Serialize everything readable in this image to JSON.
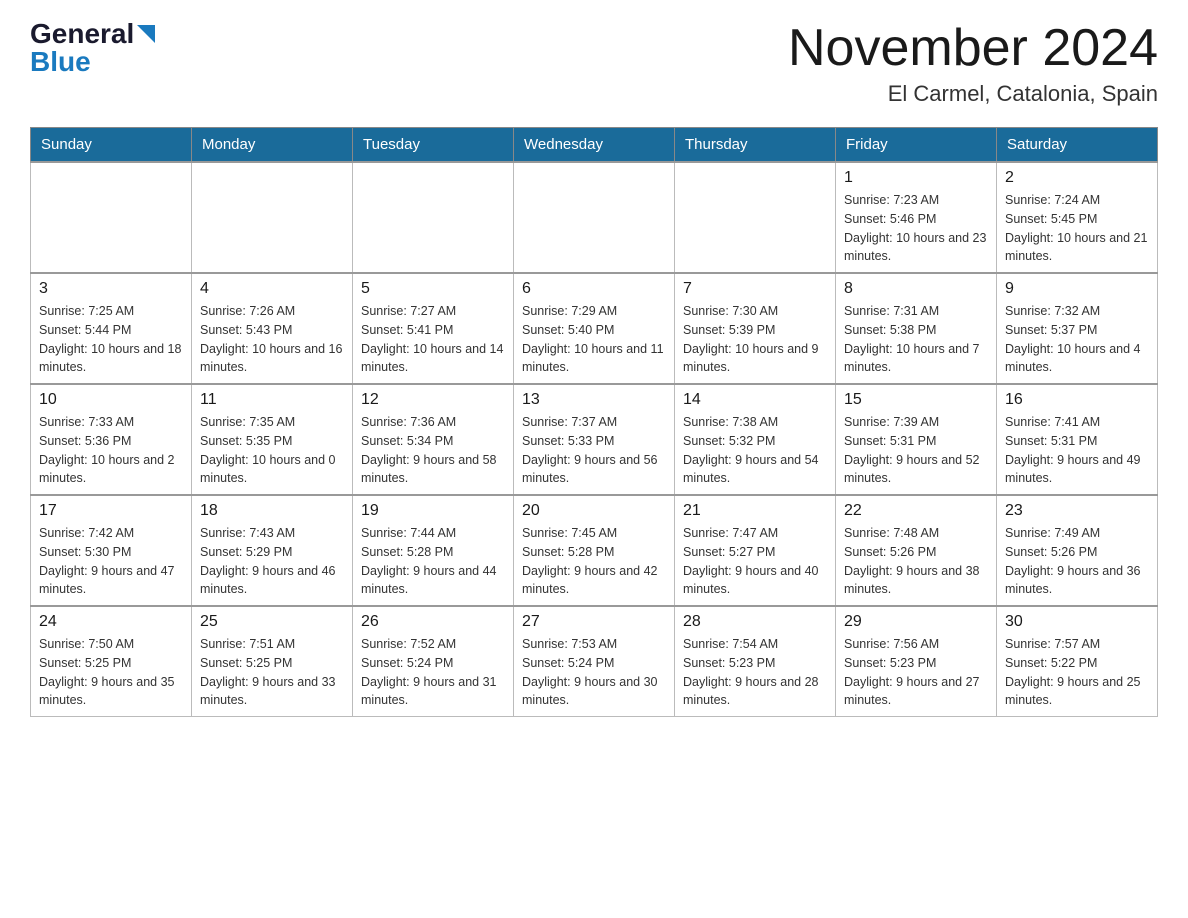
{
  "header": {
    "logo": {
      "general": "General",
      "blue": "Blue",
      "triangle": "▲"
    },
    "title": "November 2024",
    "location": "El Carmel, Catalonia, Spain"
  },
  "weekdays": [
    "Sunday",
    "Monday",
    "Tuesday",
    "Wednesday",
    "Thursday",
    "Friday",
    "Saturday"
  ],
  "weeks": [
    {
      "days": [
        {
          "num": "",
          "sunrise": "",
          "sunset": "",
          "daylight": "",
          "empty": true
        },
        {
          "num": "",
          "sunrise": "",
          "sunset": "",
          "daylight": "",
          "empty": true
        },
        {
          "num": "",
          "sunrise": "",
          "sunset": "",
          "daylight": "",
          "empty": true
        },
        {
          "num": "",
          "sunrise": "",
          "sunset": "",
          "daylight": "",
          "empty": true
        },
        {
          "num": "",
          "sunrise": "",
          "sunset": "",
          "daylight": "",
          "empty": true
        },
        {
          "num": "1",
          "sunrise": "Sunrise: 7:23 AM",
          "sunset": "Sunset: 5:46 PM",
          "daylight": "Daylight: 10 hours and 23 minutes."
        },
        {
          "num": "2",
          "sunrise": "Sunrise: 7:24 AM",
          "sunset": "Sunset: 5:45 PM",
          "daylight": "Daylight: 10 hours and 21 minutes."
        }
      ]
    },
    {
      "days": [
        {
          "num": "3",
          "sunrise": "Sunrise: 7:25 AM",
          "sunset": "Sunset: 5:44 PM",
          "daylight": "Daylight: 10 hours and 18 minutes."
        },
        {
          "num": "4",
          "sunrise": "Sunrise: 7:26 AM",
          "sunset": "Sunset: 5:43 PM",
          "daylight": "Daylight: 10 hours and 16 minutes."
        },
        {
          "num": "5",
          "sunrise": "Sunrise: 7:27 AM",
          "sunset": "Sunset: 5:41 PM",
          "daylight": "Daylight: 10 hours and 14 minutes."
        },
        {
          "num": "6",
          "sunrise": "Sunrise: 7:29 AM",
          "sunset": "Sunset: 5:40 PM",
          "daylight": "Daylight: 10 hours and 11 minutes."
        },
        {
          "num": "7",
          "sunrise": "Sunrise: 7:30 AM",
          "sunset": "Sunset: 5:39 PM",
          "daylight": "Daylight: 10 hours and 9 minutes."
        },
        {
          "num": "8",
          "sunrise": "Sunrise: 7:31 AM",
          "sunset": "Sunset: 5:38 PM",
          "daylight": "Daylight: 10 hours and 7 minutes."
        },
        {
          "num": "9",
          "sunrise": "Sunrise: 7:32 AM",
          "sunset": "Sunset: 5:37 PM",
          "daylight": "Daylight: 10 hours and 4 minutes."
        }
      ]
    },
    {
      "days": [
        {
          "num": "10",
          "sunrise": "Sunrise: 7:33 AM",
          "sunset": "Sunset: 5:36 PM",
          "daylight": "Daylight: 10 hours and 2 minutes."
        },
        {
          "num": "11",
          "sunrise": "Sunrise: 7:35 AM",
          "sunset": "Sunset: 5:35 PM",
          "daylight": "Daylight: 10 hours and 0 minutes."
        },
        {
          "num": "12",
          "sunrise": "Sunrise: 7:36 AM",
          "sunset": "Sunset: 5:34 PM",
          "daylight": "Daylight: 9 hours and 58 minutes."
        },
        {
          "num": "13",
          "sunrise": "Sunrise: 7:37 AM",
          "sunset": "Sunset: 5:33 PM",
          "daylight": "Daylight: 9 hours and 56 minutes."
        },
        {
          "num": "14",
          "sunrise": "Sunrise: 7:38 AM",
          "sunset": "Sunset: 5:32 PM",
          "daylight": "Daylight: 9 hours and 54 minutes."
        },
        {
          "num": "15",
          "sunrise": "Sunrise: 7:39 AM",
          "sunset": "Sunset: 5:31 PM",
          "daylight": "Daylight: 9 hours and 52 minutes."
        },
        {
          "num": "16",
          "sunrise": "Sunrise: 7:41 AM",
          "sunset": "Sunset: 5:31 PM",
          "daylight": "Daylight: 9 hours and 49 minutes."
        }
      ]
    },
    {
      "days": [
        {
          "num": "17",
          "sunrise": "Sunrise: 7:42 AM",
          "sunset": "Sunset: 5:30 PM",
          "daylight": "Daylight: 9 hours and 47 minutes."
        },
        {
          "num": "18",
          "sunrise": "Sunrise: 7:43 AM",
          "sunset": "Sunset: 5:29 PM",
          "daylight": "Daylight: 9 hours and 46 minutes."
        },
        {
          "num": "19",
          "sunrise": "Sunrise: 7:44 AM",
          "sunset": "Sunset: 5:28 PM",
          "daylight": "Daylight: 9 hours and 44 minutes."
        },
        {
          "num": "20",
          "sunrise": "Sunrise: 7:45 AM",
          "sunset": "Sunset: 5:28 PM",
          "daylight": "Daylight: 9 hours and 42 minutes."
        },
        {
          "num": "21",
          "sunrise": "Sunrise: 7:47 AM",
          "sunset": "Sunset: 5:27 PM",
          "daylight": "Daylight: 9 hours and 40 minutes."
        },
        {
          "num": "22",
          "sunrise": "Sunrise: 7:48 AM",
          "sunset": "Sunset: 5:26 PM",
          "daylight": "Daylight: 9 hours and 38 minutes."
        },
        {
          "num": "23",
          "sunrise": "Sunrise: 7:49 AM",
          "sunset": "Sunset: 5:26 PM",
          "daylight": "Daylight: 9 hours and 36 minutes."
        }
      ]
    },
    {
      "days": [
        {
          "num": "24",
          "sunrise": "Sunrise: 7:50 AM",
          "sunset": "Sunset: 5:25 PM",
          "daylight": "Daylight: 9 hours and 35 minutes."
        },
        {
          "num": "25",
          "sunrise": "Sunrise: 7:51 AM",
          "sunset": "Sunset: 5:25 PM",
          "daylight": "Daylight: 9 hours and 33 minutes."
        },
        {
          "num": "26",
          "sunrise": "Sunrise: 7:52 AM",
          "sunset": "Sunset: 5:24 PM",
          "daylight": "Daylight: 9 hours and 31 minutes."
        },
        {
          "num": "27",
          "sunrise": "Sunrise: 7:53 AM",
          "sunset": "Sunset: 5:24 PM",
          "daylight": "Daylight: 9 hours and 30 minutes."
        },
        {
          "num": "28",
          "sunrise": "Sunrise: 7:54 AM",
          "sunset": "Sunset: 5:23 PM",
          "daylight": "Daylight: 9 hours and 28 minutes."
        },
        {
          "num": "29",
          "sunrise": "Sunrise: 7:56 AM",
          "sunset": "Sunset: 5:23 PM",
          "daylight": "Daylight: 9 hours and 27 minutes."
        },
        {
          "num": "30",
          "sunrise": "Sunrise: 7:57 AM",
          "sunset": "Sunset: 5:22 PM",
          "daylight": "Daylight: 9 hours and 25 minutes."
        }
      ]
    }
  ]
}
